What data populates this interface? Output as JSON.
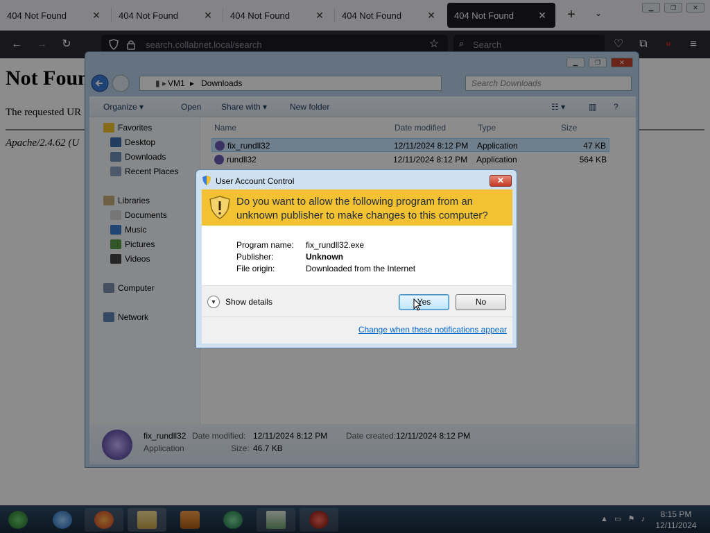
{
  "browser": {
    "tabs": [
      {
        "label": "404 Not Found",
        "close": "✕",
        "active": false
      },
      {
        "label": "404 Not Found",
        "close": "✕",
        "active": false
      },
      {
        "label": "404 Not Found",
        "close": "✕",
        "active": false
      },
      {
        "label": "404 Not Found",
        "close": "✕",
        "active": false
      },
      {
        "label": "404 Not Found",
        "close": "✕",
        "active": true
      }
    ],
    "new_tab": "+",
    "tab_list": "⌄",
    "url": "search.collabnet.local/search",
    "search_placeholder": "Search",
    "search_glyph": "⌕"
  },
  "page": {
    "heading": "Not Found",
    "message": "The requested UR",
    "address": "Apache/2.4.62 (U"
  },
  "explorer": {
    "breadcrumb": [
      "VM1",
      "Downloads"
    ],
    "search_placeholder": "Search Downloads",
    "toolbar": {
      "organize": "Organize ▾",
      "open": "Open",
      "share_with": "Share with ▾",
      "new_folder": "New folder"
    },
    "nav": {
      "favorites": "Favorites",
      "desktop": "Desktop",
      "downloads": "Downloads",
      "recent_places": "Recent Places",
      "libraries": "Libraries",
      "documents": "Documents",
      "music": "Music",
      "pictures": "Pictures",
      "videos": "Videos",
      "computer": "Computer",
      "network": "Network"
    },
    "columns": {
      "name": "Name",
      "date_modified": "Date modified",
      "type": "Type",
      "size": "Size"
    },
    "files": [
      {
        "name": "fix_rundll32",
        "date": "12/11/2024 8:12 PM",
        "type": "Application",
        "size": "47 KB",
        "selected": true
      },
      {
        "name": "rundll32",
        "date": "12/11/2024 8:12 PM",
        "type": "Application",
        "size": "564 KB",
        "selected": false
      }
    ],
    "details": {
      "name": "fix_rundll32",
      "type": "Application",
      "date_modified_label": "Date modified:",
      "date_modified": "12/11/2024 8:12 PM",
      "date_created_label": "Date created:",
      "date_created": "12/11/2024 8:12 PM",
      "size_label": "Size:",
      "size": "46.7 KB"
    }
  },
  "uac": {
    "title": "User Account Control",
    "close": "✕",
    "question": "Do you want to allow the following program from an unknown publisher to make changes to this computer?",
    "program_name_label": "Program name:",
    "program_name": "fix_rundll32.exe",
    "publisher_label": "Publisher:",
    "publisher": "Unknown",
    "file_origin_label": "File origin:",
    "file_origin": "Downloaded from the Internet",
    "show_details": "Show details",
    "yes": "Yes",
    "no": "No",
    "change_link": "Change when these notifications appear",
    "banner_color": "#f3c232"
  },
  "taskbar": {
    "time": "8:15 PM",
    "date": "12/11/2024"
  }
}
